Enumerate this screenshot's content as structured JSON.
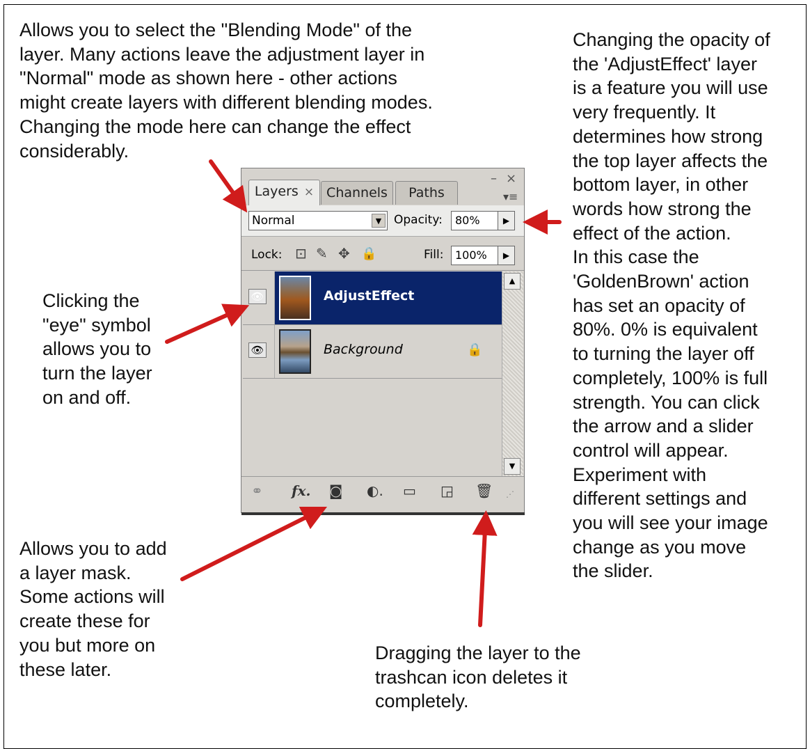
{
  "notes": {
    "blend": "Allows you to select the \"Blending Mode\" of the\nlayer. Many actions leave the adjustment layer in\n\"Normal\" mode as shown here - other actions\nmight create layers with different blending modes.\nChanging the mode here can change the effect\nconsiderably.",
    "opacity": "Changing the opacity of\nthe 'AdjustEffect' layer\nis a feature you will use\nvery frequently. It\ndetermines how strong\nthe top layer affects the\nbottom layer, in other\nwords how strong the\neffect of the action.\nIn this case the\n'GoldenBrown' action\nhas set an opacity of\n80%.  0% is equivalent\nto turning the layer off\ncompletely, 100% is full\nstrength. You can click\nthe arrow and a slider\ncontrol will appear.\nExperiment with\ndifferent settings and\nyou will see your image\nchange as you move\nthe slider.",
    "eye": "Clicking the\n\"eye\" symbol\nallows you to\nturn the layer\non and off.",
    "mask": "Allows you to add\na layer mask.\nSome actions will\ncreate these for\nyou but more on\nthese later.",
    "trash": "Dragging the layer to the\ntrashcan icon deletes it\ncompletely."
  },
  "panel": {
    "tabs": [
      {
        "label": "Layers",
        "close": "×"
      },
      {
        "label": "Channels"
      },
      {
        "label": "Paths"
      }
    ],
    "window_controls": {
      "minimize": "–",
      "close": "×",
      "menu": "▾≡"
    },
    "blend_mode": "Normal",
    "opacity_label": "Opacity:",
    "opacity_value": "80%",
    "lock_label": "Lock:",
    "fill_label": "Fill:",
    "fill_value": "100%",
    "layers": [
      {
        "name": "AdjustEffect",
        "selected": true,
        "visible": true
      },
      {
        "name": "Background",
        "selected": false,
        "visible": true,
        "locked": true
      }
    ],
    "icons": {
      "eye": "👁",
      "lock_transparent": "⊡",
      "lock_paint": "✎",
      "lock_move": "✥",
      "lock_all": "🔒",
      "link": "⚭",
      "fx": "fx.",
      "mask": "◙",
      "adjustment": "◐.",
      "group": "▭",
      "new_layer": "◲",
      "trash": "🗑",
      "grip": "⋰",
      "dropdown": "▼",
      "step": "▶",
      "scroll_up": "▲",
      "scroll_down": "▼"
    },
    "colors": {
      "selected_row": "#0a246a",
      "panel_bg": "#d6d3ce",
      "arrow": "#d01c1c"
    }
  }
}
